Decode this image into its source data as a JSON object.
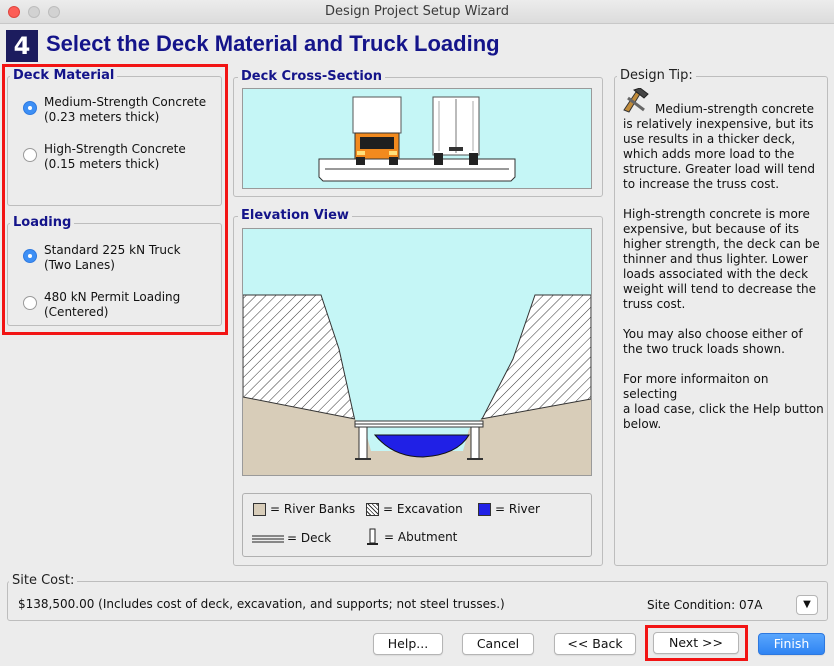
{
  "window": {
    "title": "Design Project Setup Wizard"
  },
  "header": {
    "step": "4",
    "title": "Select the Deck Material and Truck Loading"
  },
  "deck_material": {
    "label": "Deck Material",
    "options": [
      {
        "line1": "Medium-Strength Concrete",
        "line2": "(0.23 meters thick)",
        "selected": true
      },
      {
        "line1": "High-Strength Concrete",
        "line2": "(0.15 meters thick)",
        "selected": false
      }
    ]
  },
  "loading": {
    "label": "Loading",
    "options": [
      {
        "line1": "Standard 225 kN Truck",
        "line2": "(Two Lanes)",
        "selected": true
      },
      {
        "line1": "480 kN Permit Loading",
        "line2": "(Centered)",
        "selected": false
      }
    ]
  },
  "deck_cross_section": {
    "label": "Deck Cross-Section"
  },
  "elevation_view": {
    "label": "Elevation View"
  },
  "legend": {
    "river_banks": "= River Banks",
    "excavation": "= Excavation",
    "river": "= River",
    "deck": "= Deck",
    "abutment": "= Abutment"
  },
  "design_tip": {
    "label": "Design Tip:",
    "p1_first": "Medium-strength concrete",
    "p1_lines": [
      "is relatively inexpensive, but its",
      "use results in a thicker deck,",
      "which adds more load to the",
      "structure. Greater load will tend",
      "to increase the truss cost."
    ],
    "p2_lines": [
      "High-strength concrete is more",
      "expensive, but because of its",
      "higher strength, the deck can be",
      "thinner and thus lighter. Lower",
      "loads associated with the deck",
      "weight will tend to decrease the",
      "truss cost."
    ],
    "p3_lines": [
      "You may also choose either of",
      "the two truck loads shown."
    ],
    "p4_lines": [
      "For more informaiton on selecting",
      "a load case, click the Help button",
      "below."
    ]
  },
  "site_cost": {
    "label": "Site Cost:",
    "value": "$138,500.00 (Includes cost of deck, excavation, and supports; not steel trusses.)",
    "condition": "Site Condition: 07A"
  },
  "buttons": {
    "help": "Help...",
    "cancel": "Cancel",
    "back": "<< Back",
    "next": "Next >>",
    "finish": "Finish"
  },
  "colors": {
    "title": "#14148a",
    "river": "#2020e6",
    "sky": "#c5f6f6",
    "banks": "#d8cdb9",
    "highlight": "#f21414",
    "accent": "#3d8ff5"
  }
}
